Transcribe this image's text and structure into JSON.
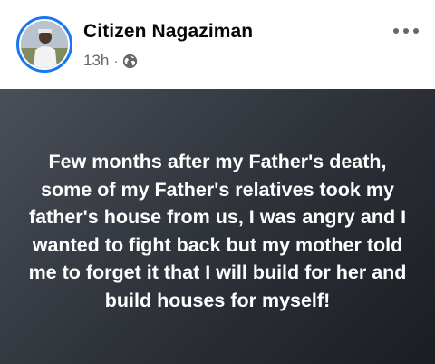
{
  "post": {
    "author_name": "Citizen Nagaziman",
    "time": "13h",
    "separator": "·",
    "privacy_icon": "globe-icon",
    "menu_icon": "more-horizontal-icon",
    "text": "Few months after my Father's death, some of my Father's relatives took my father's house from us, I was angry and I wanted to fight back but my mother told me to forget it that I will build for her and build houses for myself!"
  },
  "colors": {
    "avatar_ring": "#1877f2",
    "meta_text": "#65676b",
    "background_start": "#4a4f59",
    "background_end": "#1b1d22"
  }
}
